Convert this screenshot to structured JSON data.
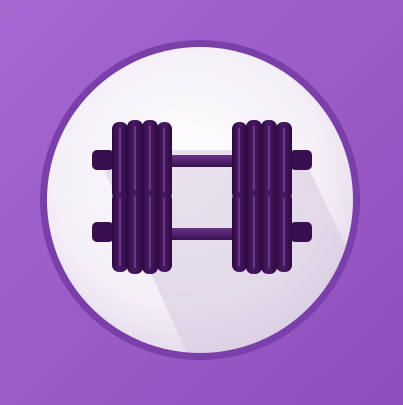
{
  "icon": {
    "name": "dumbbells-icon",
    "colors": {
      "background": "#9d5dc9",
      "ring": "#7a3ea8",
      "disc": "#f4f0f6",
      "disc_shadow": "#d9cfe1",
      "weight_dark": "#3a0f52",
      "weight_mid": "#5a2378",
      "weight_highlight": "#8a55a8"
    }
  }
}
